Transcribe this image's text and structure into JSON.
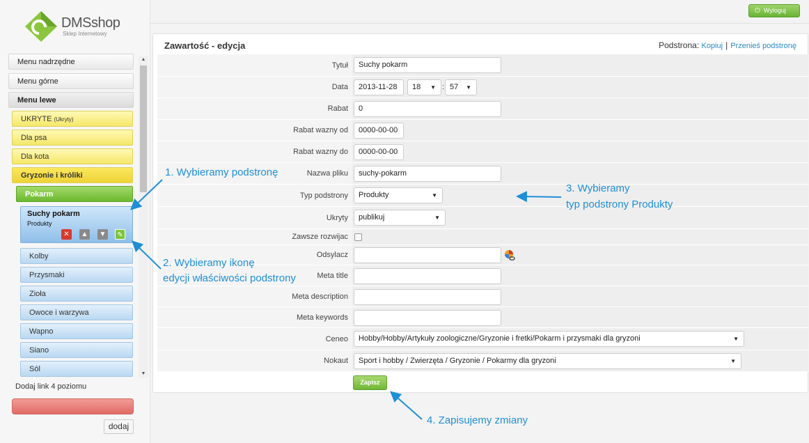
{
  "brand": {
    "name": "DMSshop",
    "tagline": "Sklep Internetowy"
  },
  "header": {
    "logout_label": "Wyloguj"
  },
  "sidebar": {
    "items": [
      {
        "label": "Menu nadrzędne"
      },
      {
        "label": "Menu górne"
      },
      {
        "label": "Menu lewe"
      },
      {
        "label": "UKRYTE",
        "sub": "(Ukryty)"
      },
      {
        "label": "Dla psa"
      },
      {
        "label": "Dla kota"
      },
      {
        "label": "Gryzonie i króliki"
      },
      {
        "label": "Pokarm"
      },
      {
        "label": "Kolby"
      },
      {
        "label": "Przysmaki"
      },
      {
        "label": "Zioła"
      },
      {
        "label": "Owoce i warzywa"
      },
      {
        "label": "Wapno"
      },
      {
        "label": "Siano"
      },
      {
        "label": "Sól"
      }
    ],
    "active_item": {
      "title": "Suchy pokarm",
      "subtitle": "Produkty"
    },
    "add_link_label": "Dodaj link 4 poziomu",
    "add_button": "dodaj"
  },
  "panel": {
    "title": "Zawartość - edycja",
    "subpage_label": "Podstrona:",
    "copy_link": "Kopiuj",
    "move_link": "Przenieś podstronę",
    "fields": {
      "title": {
        "label": "Tytuł",
        "value": "Suchy pokarm"
      },
      "date": {
        "label": "Data",
        "value": "2013-11-28",
        "hour": "18",
        "minute": "57",
        "time_sep": ":"
      },
      "discount": {
        "label": "Rabat",
        "value": "0"
      },
      "discount_from": {
        "label": "Rabat wazny od",
        "value": "0000-00-00"
      },
      "discount_to": {
        "label": "Rabat wazny do",
        "value": "0000-00-00"
      },
      "filename": {
        "label": "Nazwa pliku",
        "value": "suchy-pokarm"
      },
      "page_type": {
        "label": "Typ podstrony",
        "value": "Produkty"
      },
      "hidden": {
        "label": "Ukryty",
        "value": "publikuj"
      },
      "always_expand": {
        "label": "Zawsze rozwijac",
        "checked": false
      },
      "redirect": {
        "label": "Odsylacz",
        "value": ""
      },
      "meta_title": {
        "label": "Meta title",
        "value": ""
      },
      "meta_description": {
        "label": "Meta description",
        "value": ""
      },
      "meta_keywords": {
        "label": "Meta keywords",
        "value": ""
      },
      "ceneo": {
        "label": "Ceneo",
        "value": "Hobby/Hobby/Artykuły zoologiczne/Gryzonie i fretki/Pokarm i przysmaki dla gryzoni"
      },
      "nokaut": {
        "label": "Nokaut",
        "value": "Sport i hobby / Zwierzęta / Gryzonie / Pokarmy dla gryzoni"
      }
    },
    "save_label": "Zapisz"
  },
  "annotations": {
    "step1": "1. Wybieramy podstronę",
    "step2_line1": "2. Wybieramy ikonę",
    "step2_line2": "edycji właściwości podstrony",
    "step3_line1": "3. Wybieramy",
    "step3_line2": "typ podstrony Produkty",
    "step4": "4. Zapisujemy zmiany"
  },
  "colors": {
    "accent_blue": "#1e8fd6",
    "green_button": "#70b737",
    "link": "#2a8ac4"
  }
}
